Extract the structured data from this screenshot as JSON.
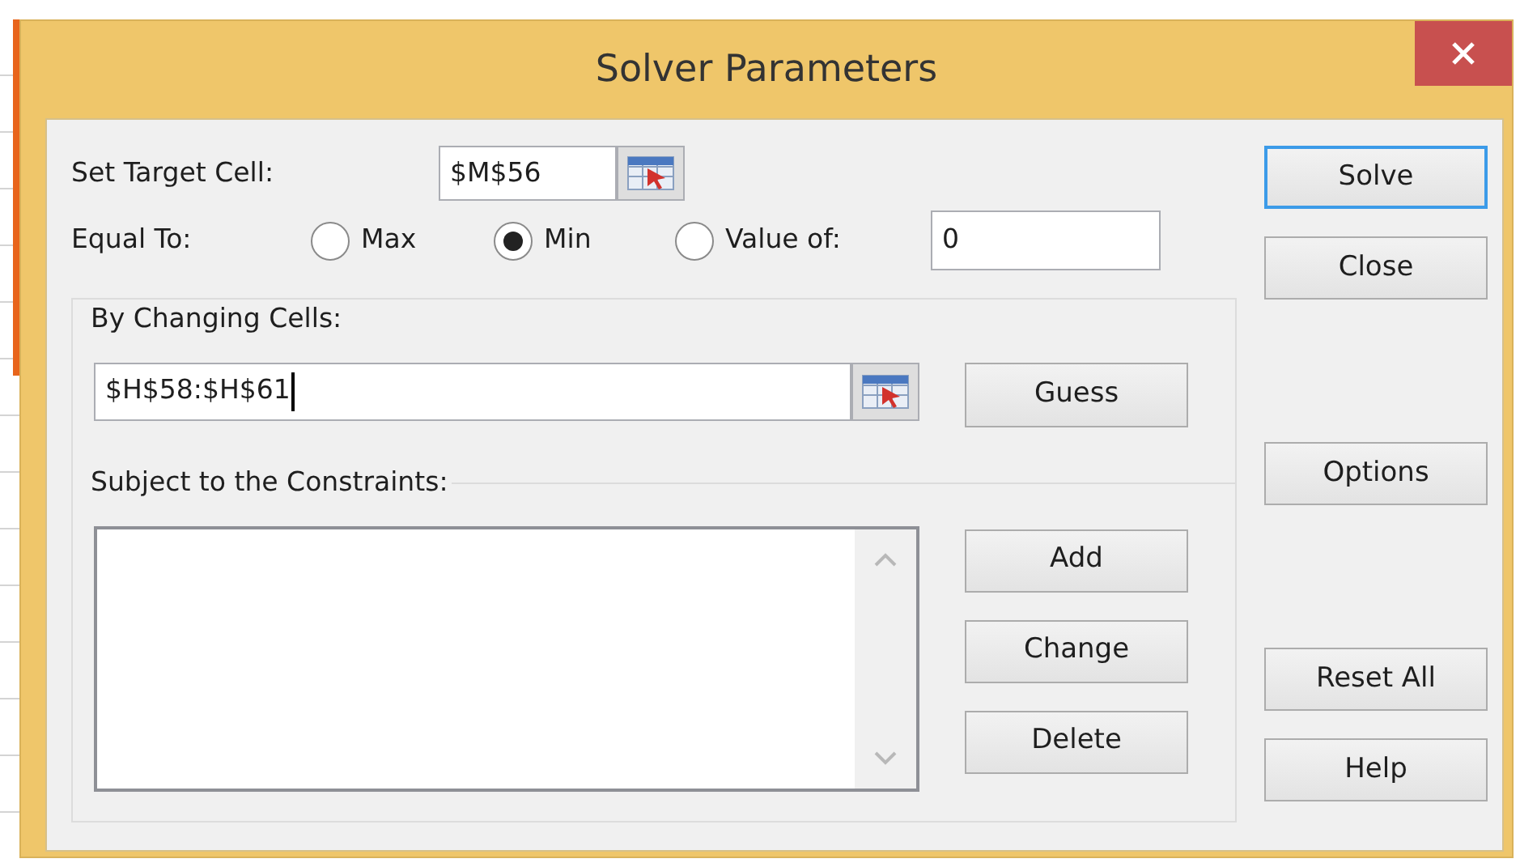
{
  "window": {
    "title": "Solver Parameters"
  },
  "target_cell": {
    "label": "Set Target Cell:",
    "value": "$M$56"
  },
  "equal_to": {
    "label": "Equal To:",
    "options": [
      {
        "label": "Max",
        "selected": false
      },
      {
        "label": "Min",
        "selected": true
      },
      {
        "label": "Value of:",
        "selected": false
      }
    ],
    "value_of": "0"
  },
  "changing_cells": {
    "label": "By Changing Cells:",
    "value": "$H$58:$H$61",
    "focused": true,
    "guess_button": {
      "label": "Guess"
    }
  },
  "constraints": {
    "label": "Subject to the Constraints:",
    "buttons": [
      {
        "label": "Add"
      },
      {
        "label": "Change"
      },
      {
        "label": "Delete"
      }
    ]
  },
  "side_buttons": [
    [
      {
        "label": "Solve",
        "focused": true
      },
      {
        "label": "Close",
        "focused": false
      }
    ],
    [
      {
        "label": "Options",
        "focused": false
      }
    ],
    [
      {
        "label": "Reset All",
        "focused": false
      },
      {
        "label": "Help",
        "focused": false
      }
    ]
  ]
}
